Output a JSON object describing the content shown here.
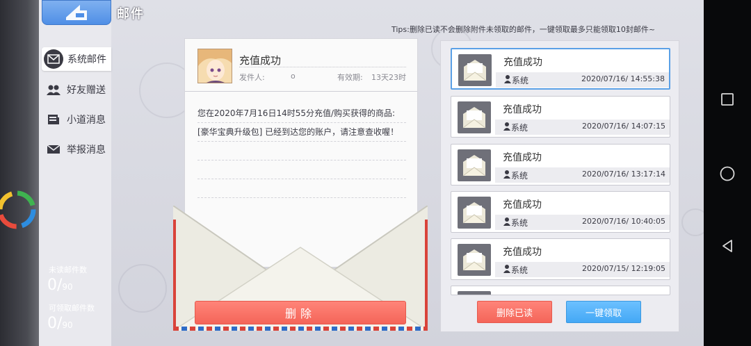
{
  "header": {
    "title": "邮件"
  },
  "tips": "Tips:删除已读不会删除附件未领取的邮件，一键领取最多只能领取10封邮件~",
  "nav": {
    "items": [
      {
        "label": "系统邮件",
        "icon": "mail-icon",
        "active": true
      },
      {
        "label": "好友赠送",
        "icon": "friends-icon",
        "active": false
      },
      {
        "label": "小道消息",
        "icon": "news-icon",
        "active": false
      },
      {
        "label": "举报消息",
        "icon": "report-icon",
        "active": false
      }
    ]
  },
  "stats": {
    "unread_label": "未读邮件数",
    "unread_value": "0",
    "unread_total": "90",
    "claimable_label": "可领取邮件数",
    "claimable_value": "0",
    "claimable_total": "90"
  },
  "letter": {
    "subject": "充值成功",
    "sender_label": "发件人:",
    "sender_value": "o",
    "valid_label": "有效期:",
    "valid_value": "13天23时",
    "body": "您在2020年7月16日14时55分充值/购买获得的商品: [豪华宝典升级包] 已经到达您的账户，请注意查收喔！",
    "delete_label": "删除"
  },
  "mail_list": [
    {
      "subject": "充值成功",
      "sender": "系统",
      "date": "2020/07/16/ 14:55:38",
      "selected": true
    },
    {
      "subject": "充值成功",
      "sender": "系统",
      "date": "2020/07/16/ 14:07:15",
      "selected": false
    },
    {
      "subject": "充值成功",
      "sender": "系统",
      "date": "2020/07/16/ 13:17:14",
      "selected": false
    },
    {
      "subject": "充值成功",
      "sender": "系统",
      "date": "2020/07/16/ 10:40:05",
      "selected": false
    },
    {
      "subject": "充值成功",
      "sender": "系统",
      "date": "2020/07/15/ 12:19:05",
      "selected": false
    }
  ],
  "actions": {
    "delete_read": "删除已读",
    "collect_all": "一键领取"
  },
  "colors": {
    "accent_blue": "#4f8fe6",
    "delete_red": "#f46559",
    "collect_blue": "#44a8f5",
    "selected_border": "#5aa0e6"
  }
}
